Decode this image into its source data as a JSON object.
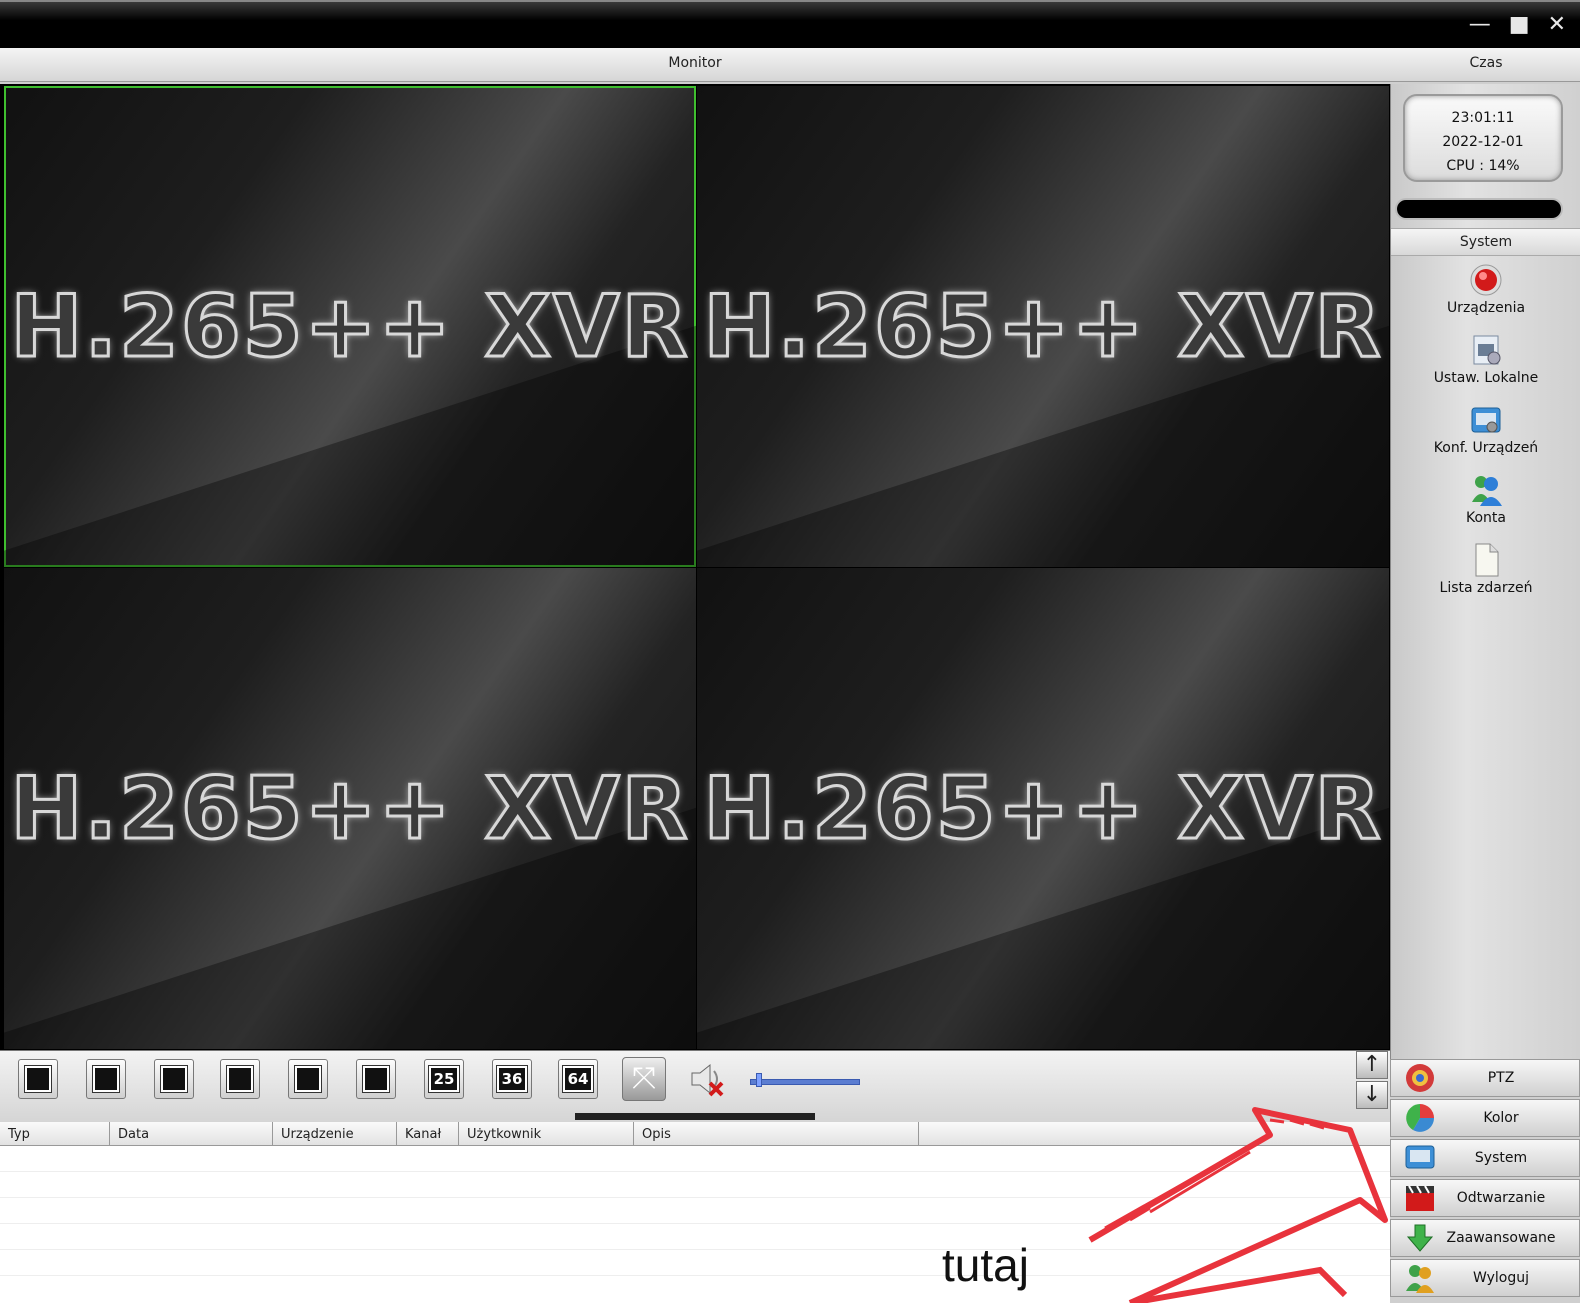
{
  "window": {
    "controls": [
      "—",
      "■",
      "✕"
    ]
  },
  "header": {
    "monitor_title": "Monitor",
    "time_title": "Czas"
  },
  "tiles": [
    {
      "label": "H.265++ XVR",
      "active": true
    },
    {
      "label": "H.265++ XVR",
      "active": false
    },
    {
      "label": "H.265++ XVR",
      "active": false
    },
    {
      "label": "H.265++ XVR",
      "active": false
    }
  ],
  "clock": {
    "time": "23:01:11",
    "date": "2022-12-01",
    "cpu": "CPU : 14%"
  },
  "system_panel": {
    "header": "System",
    "items": [
      {
        "label": "Urządzenia",
        "icon": "device-icon"
      },
      {
        "label": "Ustaw. Lokalne",
        "icon": "local-settings-icon"
      },
      {
        "label": "Konf. Urządzeń",
        "icon": "device-config-icon"
      },
      {
        "label": "Konta",
        "icon": "accounts-icon"
      },
      {
        "label": "Lista zdarzeń",
        "icon": "event-list-icon"
      }
    ]
  },
  "toolbar": {
    "layout_numbers": [
      "25",
      "36",
      "64"
    ],
    "volume_level": 0.05
  },
  "log_table": {
    "columns": [
      "Typ",
      "Data",
      "Urządzenie",
      "Kanał",
      "Użytkownik",
      "Opis",
      ""
    ]
  },
  "bottom_nav": [
    {
      "label": "PTZ",
      "icon": "ptz-icon"
    },
    {
      "label": "Kolor",
      "icon": "color-icon"
    },
    {
      "label": "System",
      "icon": "system-icon"
    },
    {
      "label": "Odtwarzanie",
      "icon": "playback-icon"
    },
    {
      "label": "Zaawansowane",
      "icon": "advanced-icon"
    },
    {
      "label": "Wyloguj",
      "icon": "logout-icon"
    }
  ],
  "annotation": {
    "text": "tutaj",
    "color": "#e8333c"
  },
  "colors": {
    "active_border": "#3fbf2f",
    "volume_bar": "#5b7dd1"
  }
}
